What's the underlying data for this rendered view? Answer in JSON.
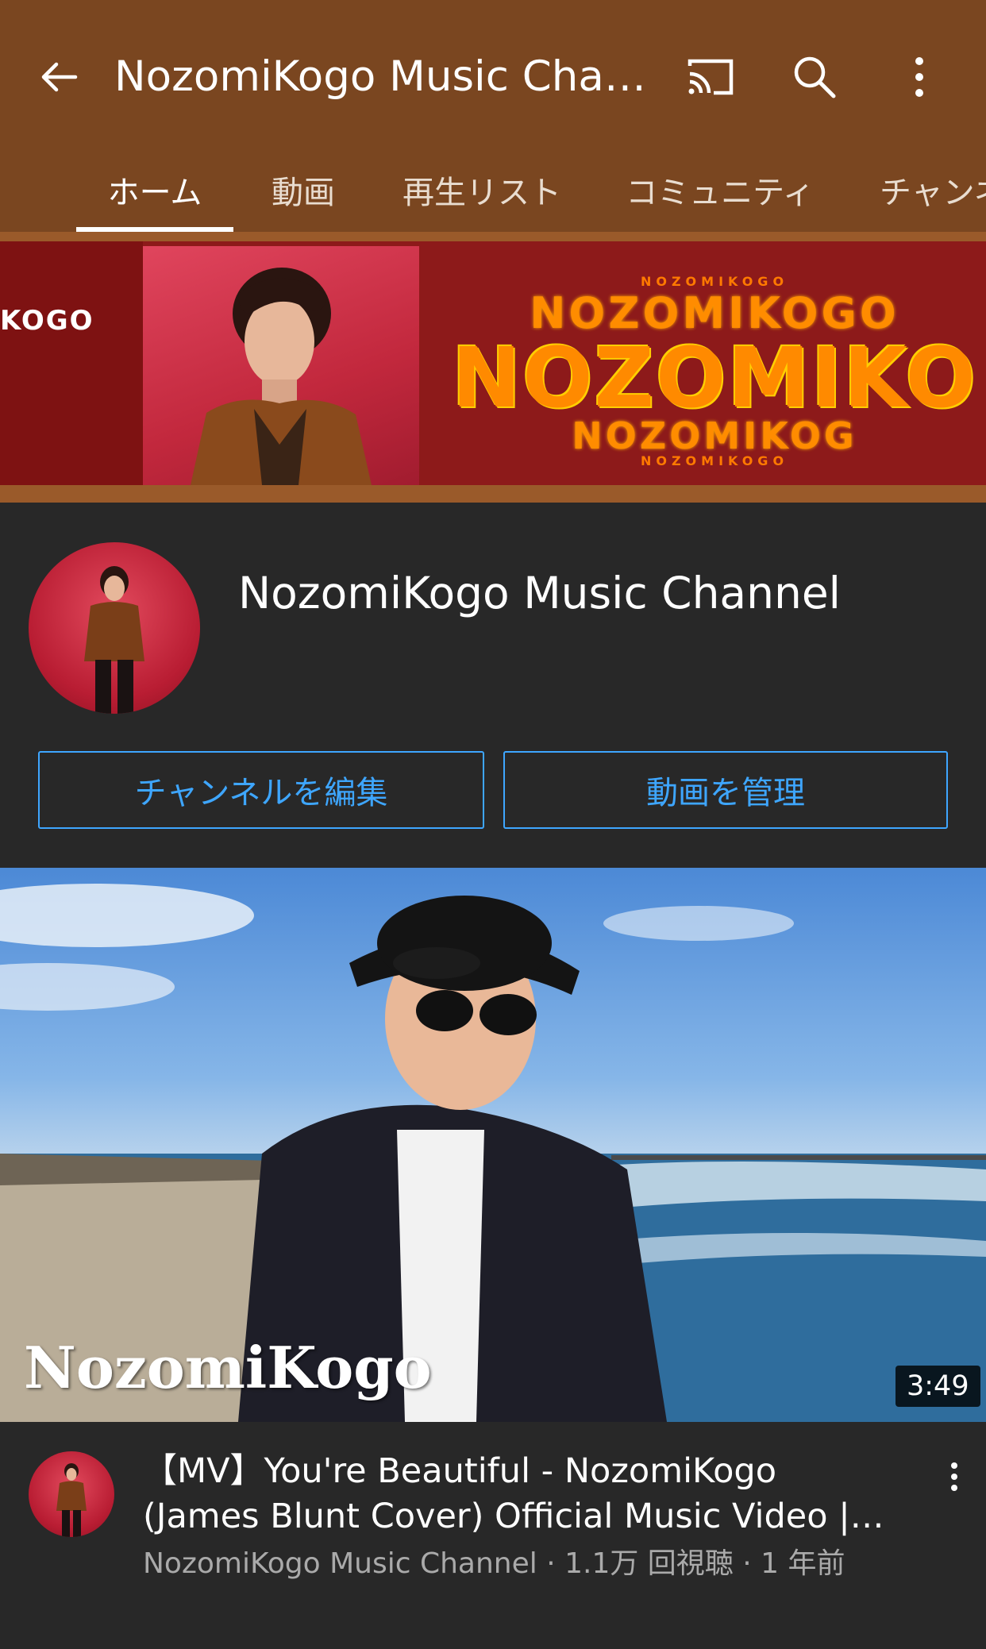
{
  "header": {
    "title": "NozomiKogo Music Chan…",
    "icons": {
      "back": "arrow-left-icon",
      "cast": "cast-icon",
      "search": "search-icon",
      "more": "more-vert-icon"
    }
  },
  "tabs": [
    {
      "label": "ホーム",
      "active": true
    },
    {
      "label": "動画",
      "active": false
    },
    {
      "label": "再生リスト",
      "active": false
    },
    {
      "label": "コミュニティ",
      "active": false
    },
    {
      "label": "チャンネ",
      "active": false
    }
  ],
  "banner": {
    "left_text": "KOGO",
    "logo_small": "NOZOMIKOGO",
    "logo_mid": "NOZOMIKOGO",
    "logo_big": "NOZOMIKO",
    "logo_mid2": "NOZOMIKOG",
    "logo_small2": "NOZOMIKOGO"
  },
  "channel": {
    "name": "NozomiKogo Music Channel",
    "edit_button": "チャンネルを編集",
    "manage_button": "動画を管理"
  },
  "video": {
    "thumbnail_watermark": "NozomiKogo",
    "duration": "3:49",
    "title_line1": "【MV】You're Beautiful -  NozomiKogo",
    "title_line2": "(James Blunt Cover) Official Music Video |…",
    "meta": "NozomiKogo Music Channel · 1.1万 回視聴 · 1 年前"
  },
  "colors": {
    "appbar": "#7a4620",
    "background": "#282828",
    "accent_blue": "#3ea6ff",
    "banner_red": "#8d1a1a",
    "logo_orange": "#ff8a00"
  }
}
